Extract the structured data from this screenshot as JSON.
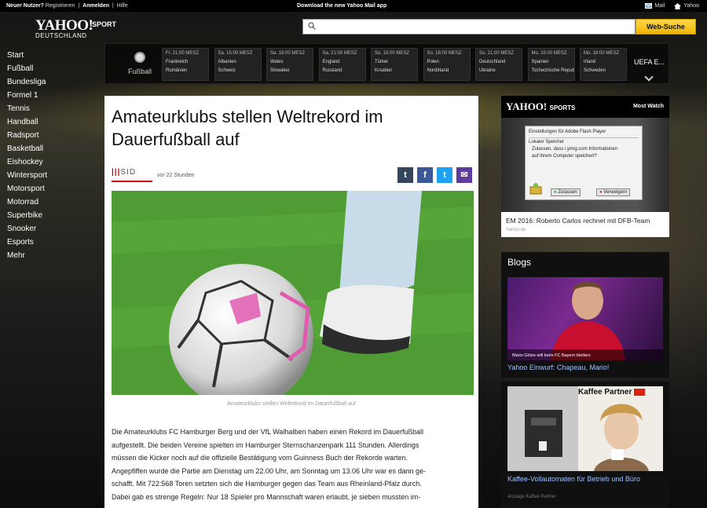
{
  "topbar": {
    "new_user": "Neuer Nutzer?",
    "register": "Registrieren",
    "login": "Anmelden",
    "help": "Hilfe",
    "promo": "Download the new Yahoo Mail app",
    "mail": "Mail",
    "yahoo": "Yahoo"
  },
  "logo": {
    "brand": "YAHOO!",
    "section": "SPORT",
    "country": "DEUTSCHLAND"
  },
  "search": {
    "placeholder": "",
    "button": "Web-Suche"
  },
  "sidenav": [
    "Start",
    "Fußball",
    "Bundesliga",
    "Formel 1",
    "Tennis",
    "Handball",
    "Radsport",
    "Basketball",
    "Eishockey",
    "Wintersport",
    "Motorsport",
    "Motorrad",
    "Superbike",
    "Snooker",
    "Esports",
    "Mehr"
  ],
  "scorebar": {
    "sport_label": "Fußball",
    "more_label": "UEFA E...",
    "matches": [
      {
        "time": "Fr. 21:00 MESZ",
        "team1": "Frankreich",
        "team2": "Rumänien"
      },
      {
        "time": "Sa. 15:00 MESZ",
        "team1": "Albanien",
        "team2": "Schweiz"
      },
      {
        "time": "Sa. 18:00 MESZ",
        "team1": "Wales",
        "team2": "Slowakei"
      },
      {
        "time": "Sa. 21:00 MESZ",
        "team1": "England",
        "team2": "Russland"
      },
      {
        "time": "So. 15:00 MESZ",
        "team1": "Türkei",
        "team2": "Kroatien"
      },
      {
        "time": "So. 18:00 MESZ",
        "team1": "Polen",
        "team2": "Nordirland"
      },
      {
        "time": "So. 21:00 MESZ",
        "team1": "Deutschland",
        "team2": "Ukraine"
      },
      {
        "time": "Mo. 15:00 MESZ",
        "team1": "Spanien",
        "team2": "Tschechische Republik"
      },
      {
        "time": "Mo. 18:00 MESZ",
        "team1": "Irland",
        "team2": "Schweden"
      }
    ]
  },
  "article": {
    "title": "Amateurklubs stellen Weltrekord im Dauerfußball auf",
    "source": "SID",
    "time": "vor 22 Stunden",
    "share": {
      "tumblr": "t",
      "facebook": "f",
      "twitter": "t",
      "mail": "✉"
    },
    "caption": "Amateurklubs stellen Weltrekord im Dauerfußball auf",
    "body_lines": [
      "Die Amateurklubs FC Hamburger Berg und der VfL Walhalben haben einen Rekord im Dauerfußball",
      "aufgestellt. Die beiden Vereine spielten im Hamburger Sternschanzenpark 111 Stunden. Allerdings",
      "müssen die Kicker noch auf die offizielle Bestätigung vom Guinness Buch der Rekorde warten.",
      "Angepfiffen wurde die Partie am Dienstag um 22.00 Uhr, am Sonntag um 13.06 Uhr war es dann ge-",
      "schafft. Mit 722:568 Toren setzten sich die Hamburger gegen das Team aus Rheinland-Pfalz durch.",
      "Dabei gab es strenge Regeln: Nur 18 Spieler pro Mannschaft waren erlaubt, je sieben mussten im-"
    ]
  },
  "most_watch": {
    "logo": "YAHOO!",
    "logo_sub": "SPORTS",
    "header": "Most Watch",
    "flash": {
      "title": "Einstellungen für Adobe Flash Player",
      "section": "Lokaler Speicher",
      "text": "Zulassen, dass i.yimg.com Informationen auf Ihrem Computer speichert?",
      "allow": "Zulassen",
      "deny": "Verweigern"
    },
    "title": "EM 2016: Roberto Carlos rechnet mit DFB-Team",
    "source": "Yahoo.de"
  },
  "blogs": {
    "header": "Blogs",
    "image_caption": "Mario Götze will beim FC Bayern bleiben",
    "title": "Yahoo Einwurf: Chapeau, Mario!"
  },
  "ad": {
    "brand": "Kaffee Partner",
    "title": "Kaffee-Vollautomaten für Betrieb und Büro",
    "source": "Anzeige Kaffee Partner"
  }
}
